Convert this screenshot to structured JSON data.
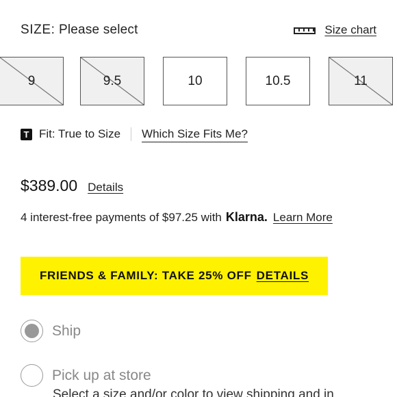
{
  "size_selector": {
    "label": "SIZE:",
    "value": "Please select",
    "size_chart_label": "Size chart",
    "size_chart_icon": "ruler-icon",
    "sizes": [
      {
        "label": "9",
        "available": false
      },
      {
        "label": "9.5",
        "available": false
      },
      {
        "label": "10",
        "available": true
      },
      {
        "label": "10.5",
        "available": true
      },
      {
        "label": "11",
        "available": false
      }
    ]
  },
  "fit": {
    "badge": "T",
    "text": "Fit: True to Size",
    "link": "Which Size Fits Me?"
  },
  "pricing": {
    "price": "$389.00",
    "details_link": "Details",
    "klarna_text": "4 interest-free payments of $97.25 with",
    "klarna_brand": "Klarna.",
    "klarna_link": "Learn More"
  },
  "promo": {
    "text": "FRIENDS & FAMILY: TAKE 25% OFF",
    "link": "DETAILS",
    "color": "#fff200"
  },
  "delivery": {
    "options": [
      {
        "label": "Ship",
        "selected": true
      },
      {
        "label": "Pick up at store",
        "selected": false
      }
    ],
    "note": "Select a size and/or color to view shipping and in"
  }
}
